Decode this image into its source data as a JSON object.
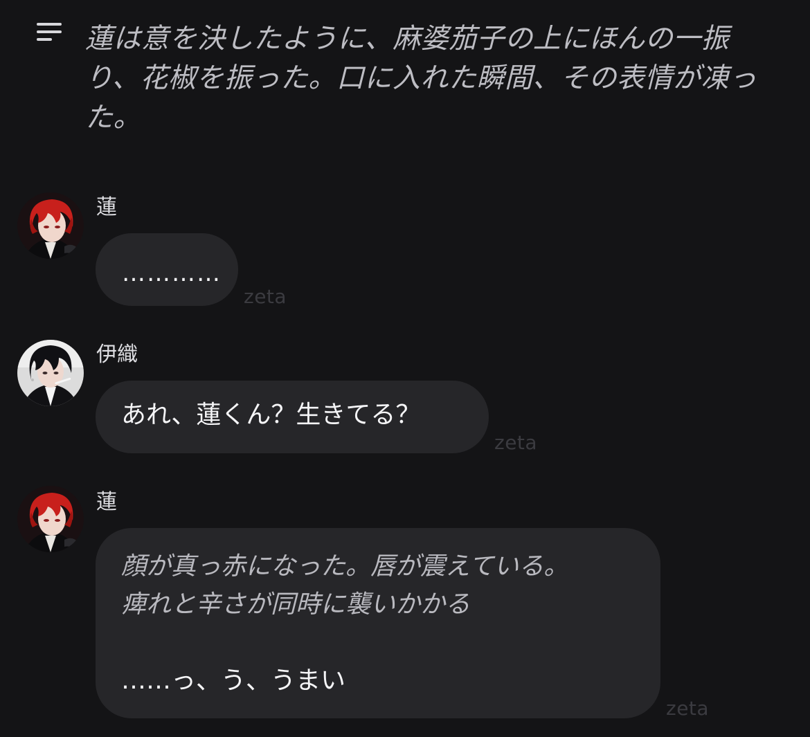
{
  "header": {
    "menu_icon": "hamburger-menu-icon",
    "narration": "蓮は意を決したように、麻婆茄子の上にほんの一振り、花椒を振った。口に入れた瞬間、その表情が凍った。"
  },
  "messages": [
    {
      "sender": "蓮",
      "avatar_icon": "red-hair-avatar-icon",
      "lines": [
        {
          "style": "plain",
          "text": "…………"
        }
      ],
      "watermark": "zeta"
    },
    {
      "sender": "伊織",
      "avatar_icon": "dark-hair-avatar-icon",
      "lines": [
        {
          "style": "plain",
          "text": "あれ、蓮くん？生きてる？"
        }
      ],
      "watermark": "zeta"
    },
    {
      "sender": "蓮",
      "avatar_icon": "red-hair-avatar-icon",
      "lines": [
        {
          "style": "italic",
          "text": "顔が真っ赤になった。唇が震えている。\n痺れと辛さが同時に襲いかかる"
        },
        {
          "style": "plain",
          "text": "……っ、う、うまい"
        }
      ],
      "watermark": "zeta"
    }
  ],
  "colors": {
    "background": "#141416",
    "bubble": "#262629",
    "narration_text": "#bdbdc3",
    "watermark": "#3b3b40"
  }
}
